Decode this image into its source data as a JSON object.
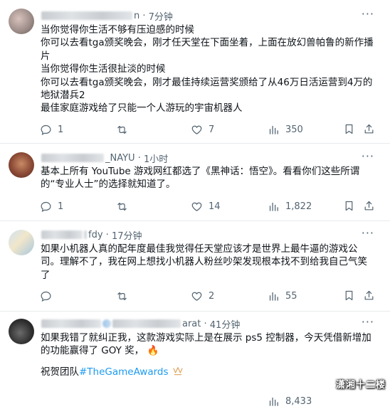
{
  "tweets": [
    {
      "handle_suffix": "n",
      "time": "7分钟",
      "more": "···",
      "lines": [
        "当你觉得你生活不够有压迫感的时候",
        "你可以去看tga颁奖晚会，刚才任天堂在下面坐着，上面在放幻兽帕鲁的新作播",
        "片",
        "当你觉得你生活很扯淡的时候",
        "你可以去看tga颁奖晚会，刚才最佳持续运营奖颁给了从46万日活运营到4万的",
        "地狱潜兵2",
        "最佳家庭游戏给了只能一个人游玩的宇宙机器人"
      ],
      "replies": "1",
      "retweets": "",
      "likes": "7",
      "views": "350"
    },
    {
      "handle_suffix": "_NAYU",
      "time": "1小时",
      "more": "···",
      "lines": [
        "基本上所有 YouTube 游戏网红都选了《黑神话：悟空》。看看你们这些所谓",
        "的“专业人士”的选择就知道了。"
      ],
      "replies": "1",
      "retweets": "",
      "likes": "14",
      "views": "1,822"
    },
    {
      "handle_suffix": "fdy",
      "time": "17分钟",
      "more": "···",
      "lines": [
        "如果小机器人真的配年度最佳我觉得任天堂应该才是世界上最牛逼的游戏公",
        "司。理解不了，我在网上想找小机器人粉丝吵架发现根本找不到给我自己气笑",
        "了"
      ],
      "replies": "",
      "retweets": "",
      "likes": "2",
      "views": "55"
    },
    {
      "handle_suffix": "arat",
      "time": "41分钟",
      "more": "···",
      "lines": [
        "如果我错了就纠正我，这款游戏实际上是在展示 ps5 控制器，今天凭借新增加",
        "的功能赢得了 GOY 奖，"
      ],
      "fire_emoji": "🔥",
      "hashtag_prefix": "祝贺团队",
      "hashtag": "#TheGameAwards",
      "hashtag_emoji": "trophy-icon",
      "views": "8,433"
    }
  ],
  "watermark": "潇湘十二楼",
  "colors": {
    "text": "#0f1419",
    "secondary": "#536471",
    "link": "#1d9bf0",
    "divider": "#e7ebee"
  }
}
